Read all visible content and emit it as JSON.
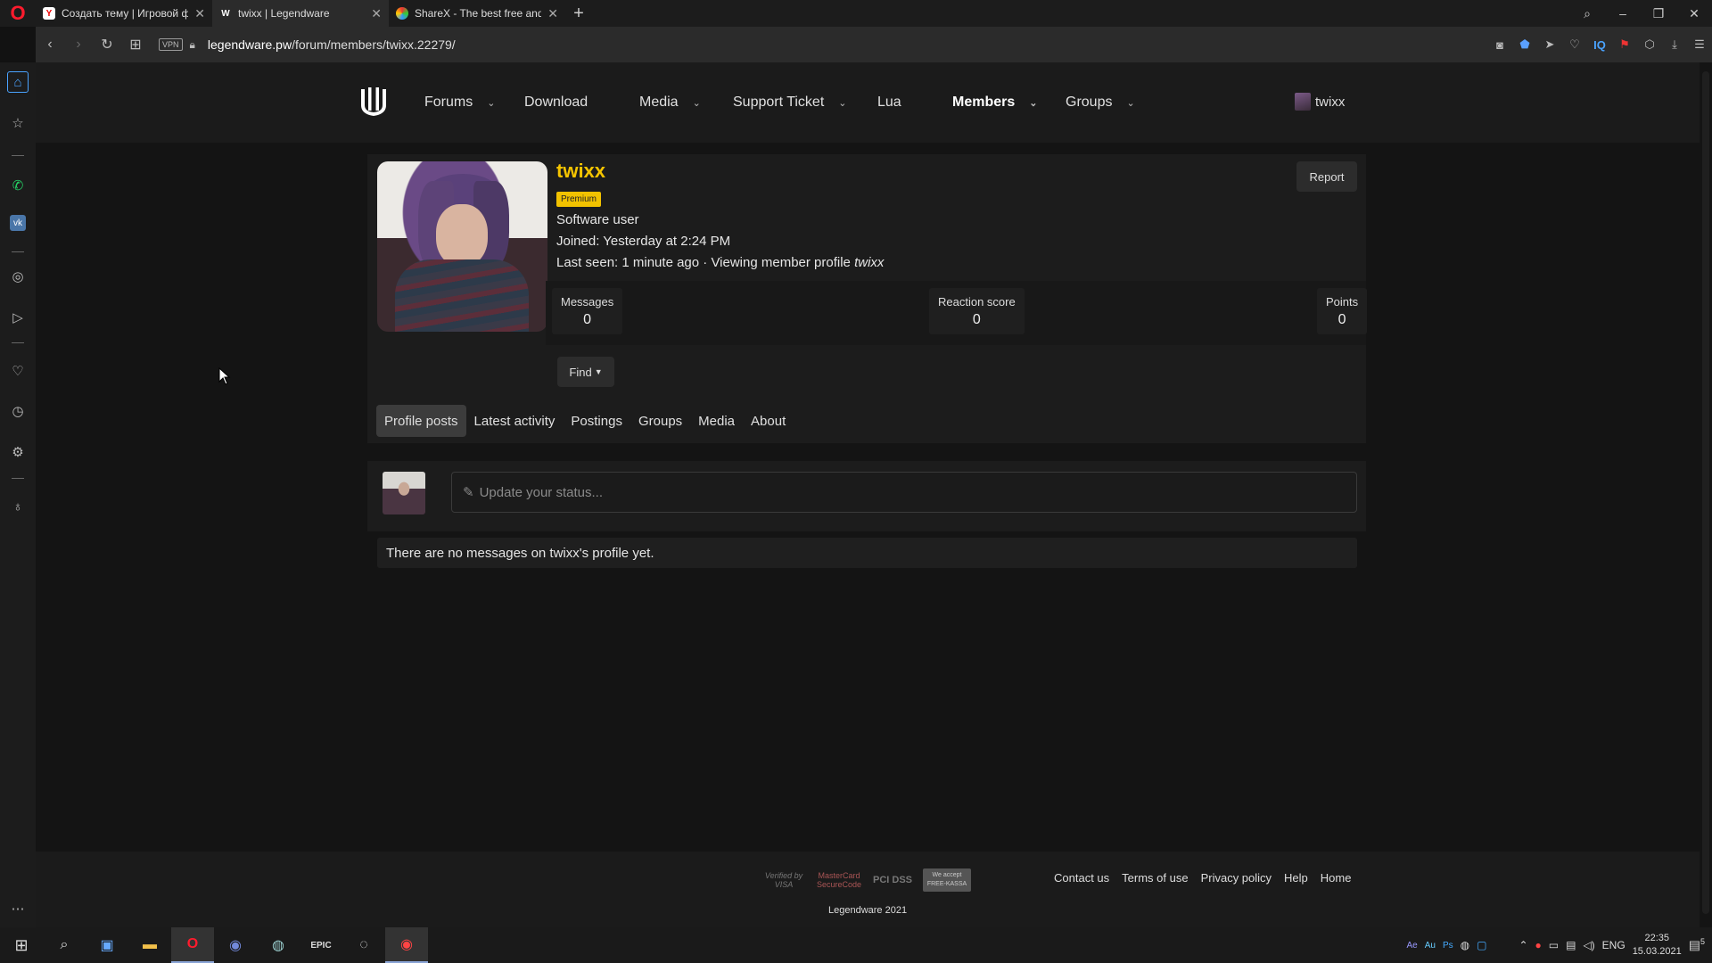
{
  "browser": {
    "tabs": [
      {
        "title": "Создать тему | Игровой ф",
        "favicon": "yandex-icon",
        "active": false
      },
      {
        "title": "twixx | Legendware",
        "favicon": "legendware-icon",
        "active": true
      },
      {
        "title": "ShareX - The best free and",
        "favicon": "sharex-icon",
        "active": false
      }
    ],
    "url_domain": "legendware.pw",
    "url_path": "/forum/members/twixx.22279/",
    "vpn_label": "VPN"
  },
  "site": {
    "nav": [
      {
        "label": "Forums",
        "dropdown": true
      },
      {
        "label": "Download",
        "dropdown": false
      },
      {
        "label": "Media",
        "dropdown": true
      },
      {
        "label": "Support Ticket",
        "dropdown": true
      },
      {
        "label": "Lua",
        "dropdown": false
      },
      {
        "label": "Members",
        "dropdown": true,
        "selected": true
      },
      {
        "label": "Groups",
        "dropdown": true
      }
    ],
    "current_user": "twixx"
  },
  "profile": {
    "username": "twixx",
    "badge": "Premium",
    "user_title": "Software user",
    "joined": "Joined: Yesterday at 2:24 PM",
    "last_seen_prefix": "Last seen: 1 minute ago · Viewing member profile ",
    "last_seen_target": "twixx",
    "report_label": "Report",
    "stats": [
      {
        "label": "Messages",
        "value": "0"
      },
      {
        "label": "Reaction score",
        "value": "0"
      },
      {
        "label": "Points",
        "value": "0"
      }
    ],
    "find_label": "Find",
    "tabs": [
      "Profile posts",
      "Latest activity",
      "Postings",
      "Groups",
      "Media",
      "About"
    ],
    "active_tab": "Profile posts"
  },
  "status": {
    "placeholder": "Update your status..."
  },
  "no_messages": "There are no messages on twixx's profile yet.",
  "footer": {
    "payment_logos": [
      "Verified by VISA",
      "MasterCard SecureCode",
      "PCI DSS",
      "We accept FREE-KASSA"
    ],
    "links": [
      "Contact us",
      "Terms of use",
      "Privacy policy",
      "Help",
      "Home"
    ],
    "copyright": "Legendware 2021"
  },
  "taskbar": {
    "lang": "ENG",
    "time": "22:35",
    "date": "15.03.2021",
    "notifications": "5"
  },
  "colors": {
    "accent_yellow": "#f5c400",
    "badge_bg": "#f2c200",
    "page_bg": "#141414",
    "card_bg": "#1c1c1c"
  }
}
